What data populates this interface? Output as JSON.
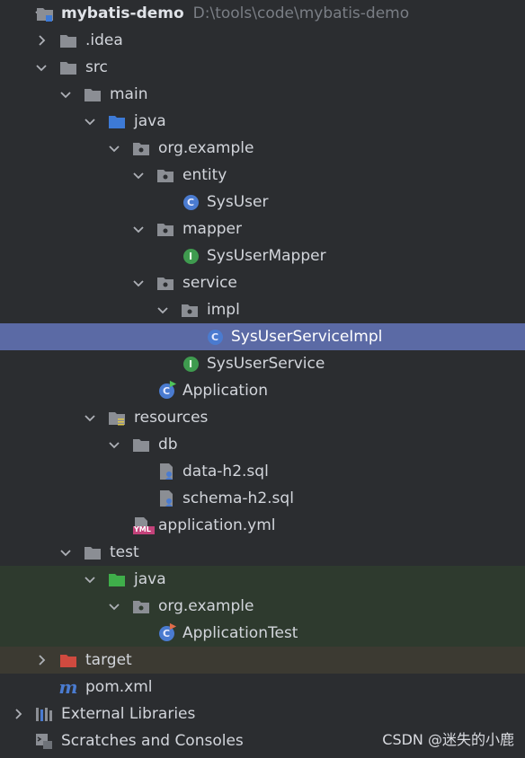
{
  "project": {
    "name": "mybatis-demo",
    "path": "D:\\tools\\code\\mybatis-demo"
  },
  "tree": {
    "idea": ".idea",
    "src": "src",
    "main": "main",
    "main_java": "java",
    "org_example": "org.example",
    "entity": "entity",
    "sys_user": "SysUser",
    "mapper": "mapper",
    "sys_user_mapper": "SysUserMapper",
    "service": "service",
    "impl": "impl",
    "sys_user_service_impl": "SysUserServiceImpl",
    "sys_user_service": "SysUserService",
    "application": "Application",
    "resources": "resources",
    "db": "db",
    "data_h2": "data-h2.sql",
    "schema_h2": "schema-h2.sql",
    "application_yml": "application.yml",
    "test": "test",
    "test_java": "java",
    "test_org_example": "org.example",
    "application_test": "ApplicationTest",
    "target": "target",
    "pom": "pom.xml",
    "external_libraries": "External Libraries",
    "scratches": "Scratches and Consoles"
  },
  "badges": {
    "class_letter": "C",
    "interface_letter": "I",
    "yml_letter": "YML",
    "maven_letter": "m"
  },
  "colors": {
    "background": "#2b2d30",
    "selection": "#5b6aa5",
    "test_background": "#2e3a2e",
    "excluded_background": "#3c3a32",
    "class_badge": "#4a7bd0",
    "interface_badge": "#3f9b4f"
  },
  "watermark": "CSDN @迷失的小鹿"
}
